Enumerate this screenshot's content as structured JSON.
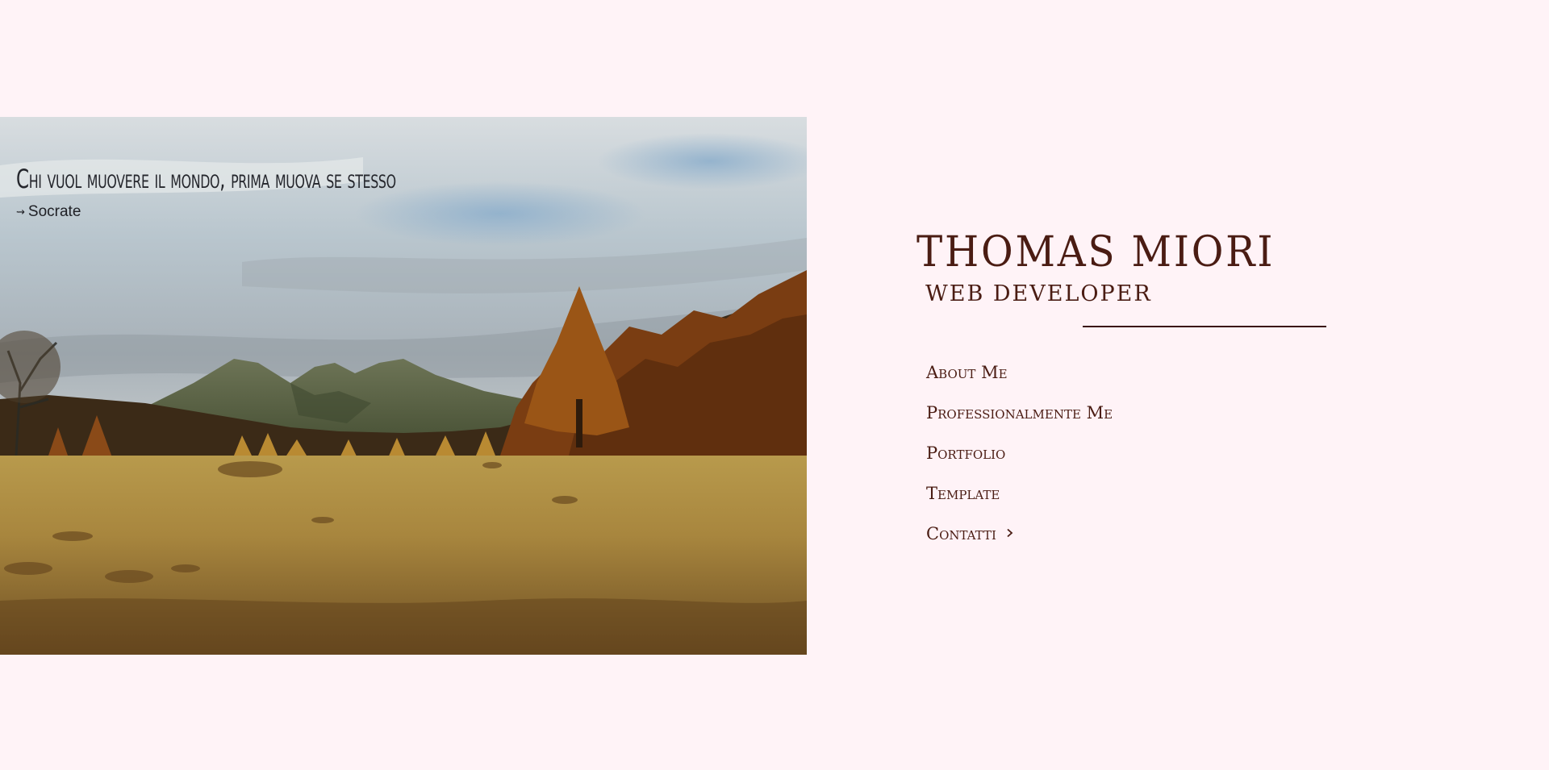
{
  "hero": {
    "quote": "Chi vuol muovere il mondo, prima muova se stesso",
    "author": "Socrate",
    "author_arrow": "⇝"
  },
  "brand": {
    "name": "THOMAS MIORI",
    "role": "WEB DEVELOPER"
  },
  "nav": {
    "items": [
      {
        "label": "About Me"
      },
      {
        "label": "Professionalmente Me"
      },
      {
        "label": "Portfolio"
      },
      {
        "label": "Template"
      },
      {
        "label": "Contatti",
        "icon": "chevron-right-icon"
      }
    ]
  },
  "colors": {
    "page_background": "#fff3f7",
    "brand_text": "#4a1c13",
    "divider": "#3a1410",
    "quote_text": "#25272d"
  }
}
